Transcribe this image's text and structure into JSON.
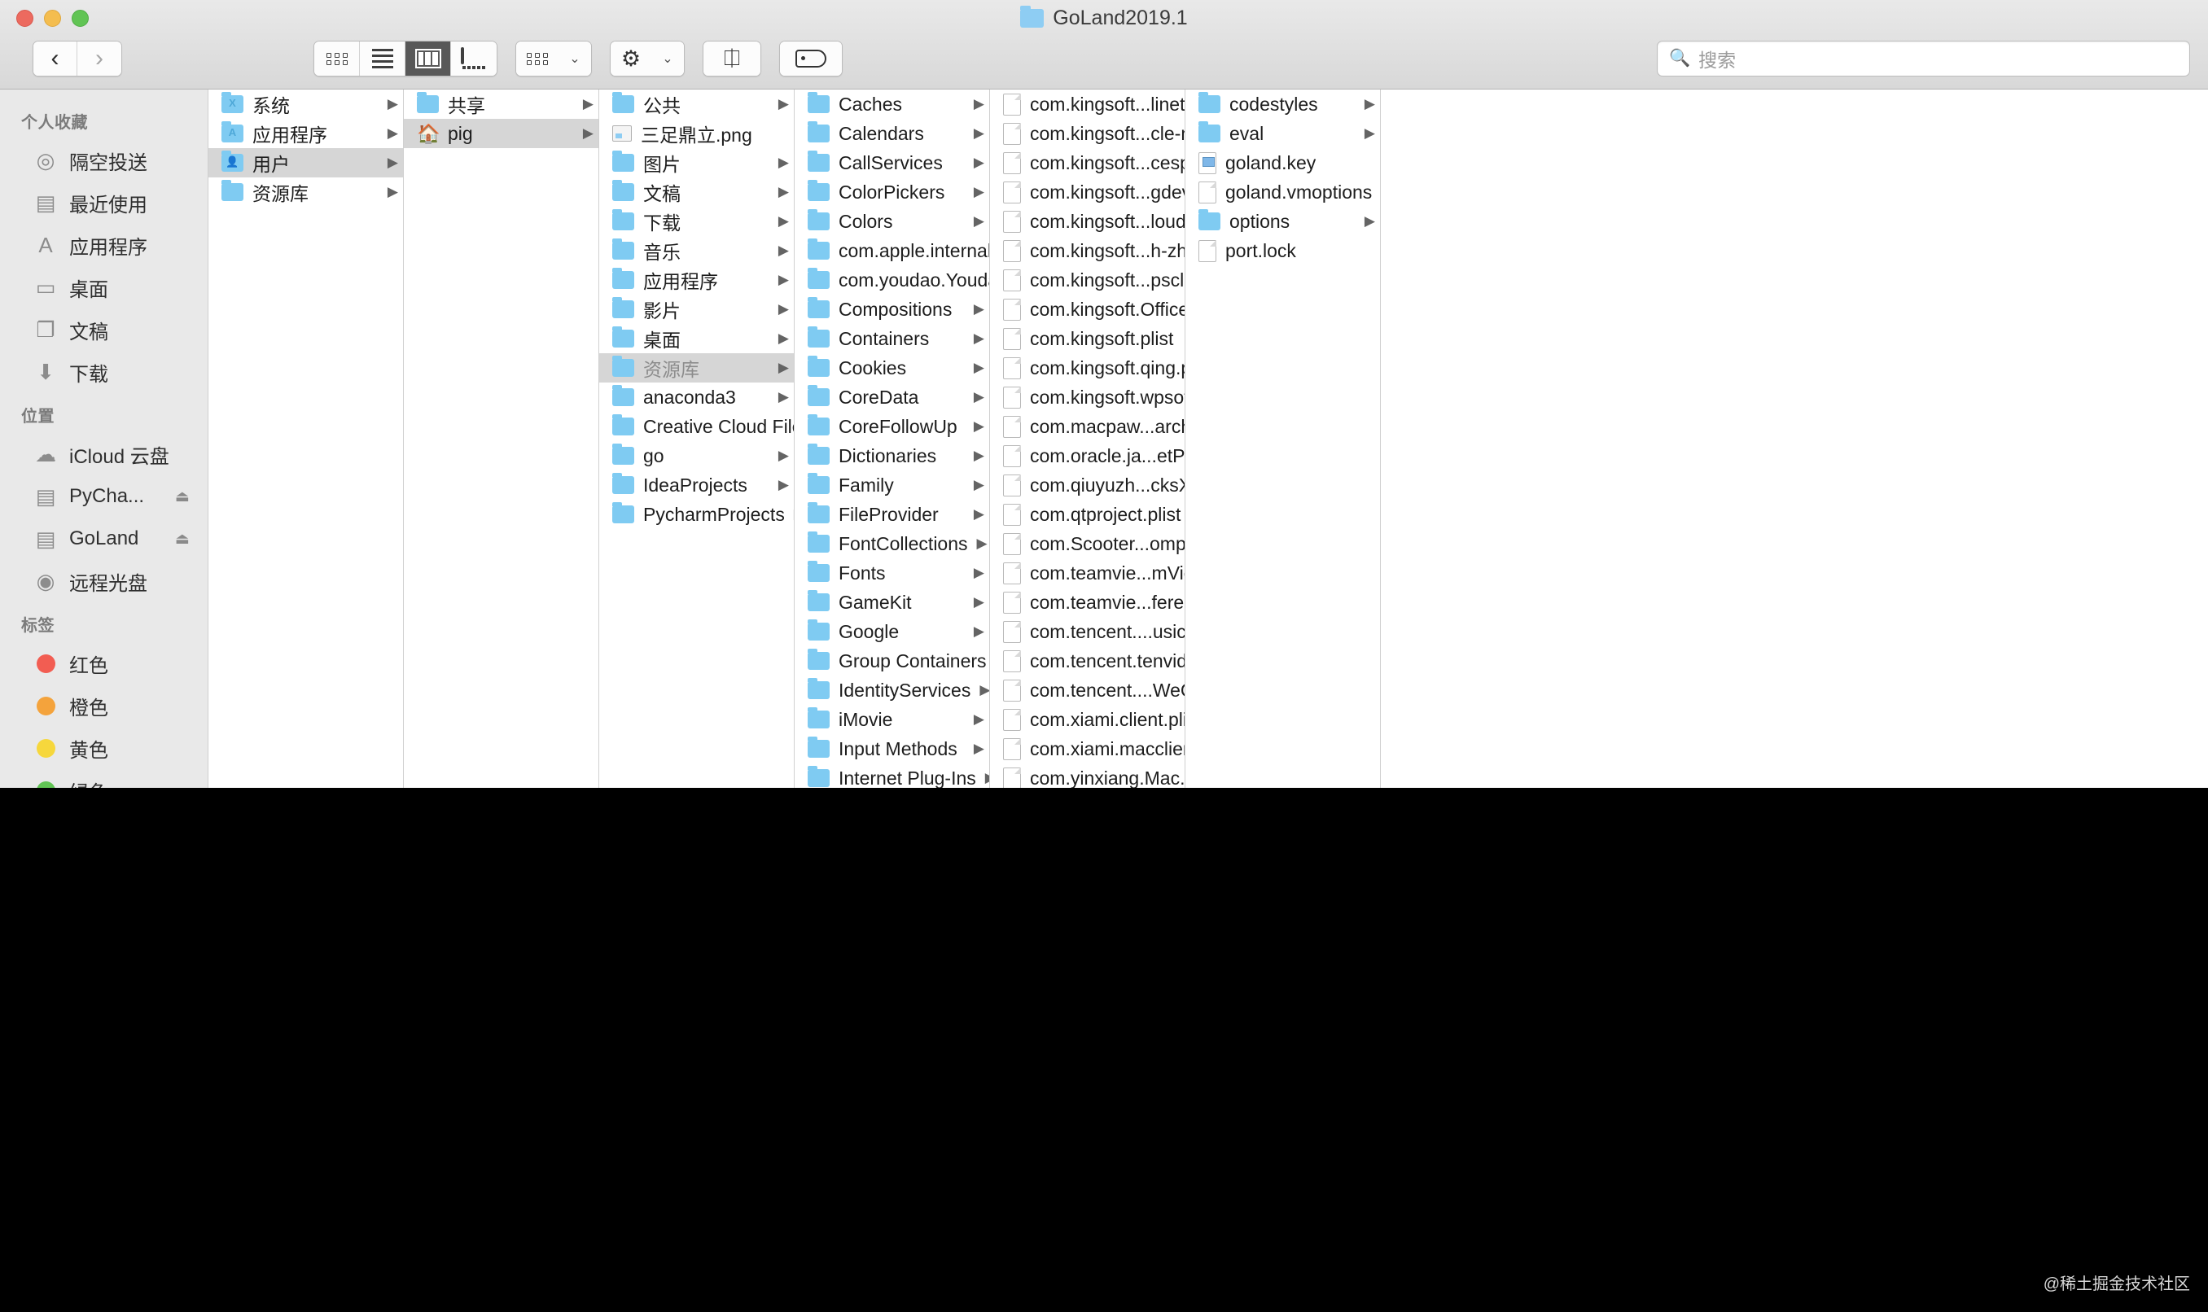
{
  "window": {
    "title": "GoLand2019.1"
  },
  "toolbar": {
    "back_label": "‹",
    "forward_label": "›",
    "view_icon_grid": "icon-view",
    "view_list": "list-view",
    "view_column": "column-view",
    "view_gallery": "gallery-view",
    "group_label": "group-by",
    "action_label": "action-gear",
    "share_label": "⇧",
    "tags_label": "tags",
    "chevron": "⌄"
  },
  "search": {
    "placeholder": "搜索",
    "icon": "search-icon"
  },
  "sidebar": {
    "sections": [
      {
        "header": "个人收藏",
        "items": [
          {
            "label": "隔空投送",
            "icon": "airdrop-icon"
          },
          {
            "label": "最近使用",
            "icon": "recents-icon"
          },
          {
            "label": "应用程序",
            "icon": "applications-icon"
          },
          {
            "label": "桌面",
            "icon": "desktop-icon"
          },
          {
            "label": "文稿",
            "icon": "documents-icon"
          },
          {
            "label": "下载",
            "icon": "downloads-icon"
          }
        ]
      },
      {
        "header": "位置",
        "items": [
          {
            "label": "iCloud 云盘",
            "icon": "icloud-icon"
          },
          {
            "label": "PyCha...",
            "icon": "disk-icon",
            "eject": "⏏"
          },
          {
            "label": "GoLand",
            "icon": "disk-icon",
            "eject": "⏏"
          },
          {
            "label": "远程光盘",
            "icon": "remote-disc-icon"
          }
        ]
      },
      {
        "header": "标签",
        "items": [
          {
            "label": "红色",
            "icon": "tag-dot-icon",
            "color": "#f25d52"
          },
          {
            "label": "橙色",
            "icon": "tag-dot-icon",
            "color": "#f4a33c"
          },
          {
            "label": "黄色",
            "icon": "tag-dot-icon",
            "color": "#f6d73c"
          },
          {
            "label": "绿色",
            "icon": "tag-dot-icon",
            "color": "#61c454"
          }
        ]
      }
    ]
  },
  "columns": [
    {
      "name": "column-volume-root",
      "items": [
        {
          "label": "系统",
          "type": "folder",
          "glyph": "X",
          "arrow": true
        },
        {
          "label": "应用程序",
          "type": "folder",
          "glyph": "A",
          "arrow": true
        },
        {
          "label": "用户",
          "type": "folder",
          "glyph": "👤",
          "arrow": true,
          "selected": true
        },
        {
          "label": "资源库",
          "type": "folder",
          "arrow": true
        }
      ]
    },
    {
      "name": "column-users",
      "items": [
        {
          "label": "共享",
          "type": "folder",
          "arrow": true
        },
        {
          "label": "pig",
          "type": "home",
          "arrow": true,
          "selected": true
        }
      ]
    },
    {
      "name": "column-home",
      "items": [
        {
          "label": "公共",
          "type": "folder",
          "arrow": true
        },
        {
          "label": "三足鼎立.png",
          "type": "image"
        },
        {
          "label": "图片",
          "type": "folder",
          "arrow": true
        },
        {
          "label": "文稿",
          "type": "folder",
          "arrow": true
        },
        {
          "label": "下载",
          "type": "folder",
          "arrow": true
        },
        {
          "label": "音乐",
          "type": "folder",
          "arrow": true
        },
        {
          "label": "应用程序",
          "type": "folder",
          "arrow": true
        },
        {
          "label": "影片",
          "type": "folder",
          "arrow": true
        },
        {
          "label": "桌面",
          "type": "folder",
          "arrow": true
        },
        {
          "label": "资源库",
          "type": "folder",
          "arrow": true,
          "selected": true,
          "dim": true
        },
        {
          "label": "anaconda3",
          "type": "folder",
          "arrow": true
        },
        {
          "label": "Creative Cloud Files",
          "type": "folder",
          "arrow": true
        },
        {
          "label": "go",
          "type": "folder",
          "arrow": true
        },
        {
          "label": "IdeaProjects",
          "type": "folder",
          "arrow": true
        },
        {
          "label": "PycharmProjects",
          "type": "folder",
          "arrow": true
        }
      ]
    },
    {
      "name": "column-library",
      "items": [
        {
          "label": "Caches",
          "type": "folder",
          "arrow": true
        },
        {
          "label": "Calendars",
          "type": "folder",
          "arrow": true
        },
        {
          "label": "CallServices",
          "type": "folder",
          "arrow": true
        },
        {
          "label": "ColorPickers",
          "type": "folder",
          "arrow": true
        },
        {
          "label": "Colors",
          "type": "folder",
          "arrow": true
        },
        {
          "label": "com.apple.internal.ck",
          "type": "folder",
          "arrow": true
        },
        {
          "label": "com.youdao.YoudaoDict",
          "type": "folder",
          "arrow": true
        },
        {
          "label": "Compositions",
          "type": "folder",
          "arrow": true
        },
        {
          "label": "Containers",
          "type": "folder",
          "arrow": true
        },
        {
          "label": "Cookies",
          "type": "folder",
          "arrow": true
        },
        {
          "label": "CoreData",
          "type": "folder",
          "arrow": true
        },
        {
          "label": "CoreFollowUp",
          "type": "folder",
          "arrow": true
        },
        {
          "label": "Dictionaries",
          "type": "folder",
          "arrow": true
        },
        {
          "label": "Family",
          "type": "folder",
          "arrow": true
        },
        {
          "label": "FileProvider",
          "type": "folder",
          "arrow": true
        },
        {
          "label": "FontCollections",
          "type": "folder",
          "arrow": true
        },
        {
          "label": "Fonts",
          "type": "folder",
          "arrow": true
        },
        {
          "label": "GameKit",
          "type": "folder",
          "arrow": true
        },
        {
          "label": "Google",
          "type": "folder",
          "arrow": true
        },
        {
          "label": "Group Containers",
          "type": "folder",
          "arrow": true
        },
        {
          "label": "IdentityServices",
          "type": "folder",
          "arrow": true
        },
        {
          "label": "iMovie",
          "type": "folder",
          "arrow": true
        },
        {
          "label": "Input Methods",
          "type": "folder",
          "arrow": true
        },
        {
          "label": "Internet Plug-Ins",
          "type": "folder",
          "arrow": true
        }
      ]
    },
    {
      "name": "column-preferences",
      "items": [
        {
          "label": "com.kingsoft...linetime.plist",
          "type": "doc"
        },
        {
          "label": "com.kingsoft...cle-man.plist",
          "type": "doc"
        },
        {
          "label": "com.kingsoft...cespace.plist",
          "type": "doc"
        },
        {
          "label": "com.kingsoft...gdevice.plist",
          "type": "doc"
        },
        {
          "label": "com.kingsoft...louddisk.plist",
          "type": "doc"
        },
        {
          "label": "com.kingsoft...h-zh-cn.plist",
          "type": "doc"
        },
        {
          "label": "com.kingsoft...pscloud.plist",
          "type": "doc"
        },
        {
          "label": "com.kingsoft.Office.plist",
          "type": "doc"
        },
        {
          "label": "com.kingsoft.plist",
          "type": "doc"
        },
        {
          "label": "com.kingsoft.qing.plist",
          "type": "doc"
        },
        {
          "label": "com.kingsoft.wpsoffice.plist",
          "type": "doc"
        },
        {
          "label": "com.macpaw...archiver.plist",
          "type": "doc"
        },
        {
          "label": "com.oracle.ja...etPlugin.plist",
          "type": "doc"
        },
        {
          "label": "com.qiuyuzh...cksX-NG.plist",
          "type": "doc"
        },
        {
          "label": "com.qtproject.plist",
          "type": "doc"
        },
        {
          "label": "com.Scooter...ompare.plist",
          "type": "doc"
        },
        {
          "label": "com.teamvie...mViewer.plist",
          "type": "doc"
        },
        {
          "label": "com.teamvie...ferences.plist",
          "type": "doc"
        },
        {
          "label": "com.tencent....usicMac.plist",
          "type": "doc"
        },
        {
          "label": "com.tencent.tenvideo.plist",
          "type": "doc"
        },
        {
          "label": "com.tencent....WeChat.plist",
          "type": "doc"
        },
        {
          "label": "com.xiami.client.plist",
          "type": "doc"
        },
        {
          "label": "com.xiami.macclient.plist",
          "type": "doc"
        },
        {
          "label": "com.yinxiang.Mac.plist",
          "type": "doc"
        }
      ]
    },
    {
      "name": "column-goland-contents",
      "items": [
        {
          "label": "codestyles",
          "type": "folder",
          "arrow": true
        },
        {
          "label": "eval",
          "type": "folder",
          "arrow": true
        },
        {
          "label": "goland.key",
          "type": "key"
        },
        {
          "label": "goland.vmoptions",
          "type": "doc"
        },
        {
          "label": "options",
          "type": "folder",
          "arrow": true
        },
        {
          "label": "port.lock",
          "type": "doc"
        }
      ]
    }
  ],
  "watermark": "@稀土掘金技术社区"
}
